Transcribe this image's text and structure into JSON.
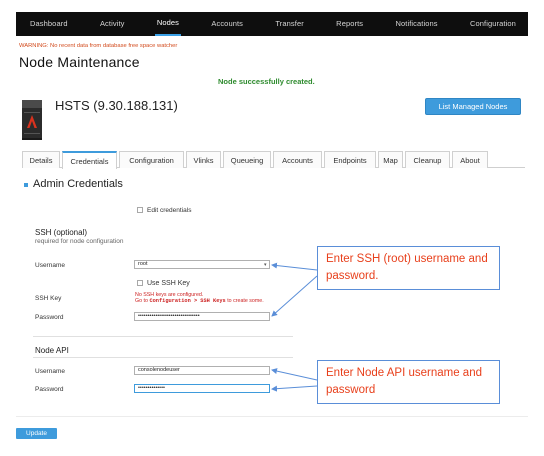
{
  "nav": {
    "items": [
      "Dashboard",
      "Activity",
      "Nodes",
      "Accounts",
      "Transfer",
      "Reports",
      "Notifications",
      "Configuration"
    ],
    "active_index": 2
  },
  "warning": "WARNING: No recent data from database free space watcher",
  "page_title": "Node Maintenance",
  "success_message": "Node successfully created.",
  "node": {
    "name": "HSTS (9.30.188.131)",
    "icon": "server-node-icon"
  },
  "managed_nodes_button": "List Managed Nodes",
  "tabs": {
    "items": [
      "Details",
      "Credentials",
      "Configuration",
      "Vlinks",
      "Queueing",
      "Accounts",
      "Endpoints",
      "Map",
      "Cleanup",
      "About"
    ],
    "active_index": 1
  },
  "section_title": "Admin Credentials",
  "edit_credentials_label": "Edit credentials",
  "ssh": {
    "title": "SSH (optional)",
    "subtitle": "required for node configuration",
    "username_label": "Username",
    "username_value": "root",
    "use_ssh_key_label": "Use SSH Key",
    "ssh_key_label": "SSH Key",
    "no_keys_msg": "No SSH keys are configured.",
    "goto_prefix": "Go to ",
    "goto_path": "Configuration > SSH Keys",
    "goto_suffix": " to create some.",
    "password_label": "Password",
    "password_value": "••••••••••••••••••••••••••••••••"
  },
  "node_api": {
    "title": "Node API",
    "username_label": "Username",
    "username_value": "consolenodeuser",
    "password_label": "Password",
    "password_value": "••••••••••••••"
  },
  "callouts": {
    "ssh": "Enter SSH (root) username and password.",
    "api": "Enter Node API username and password"
  },
  "update_button": "Update",
  "colors": {
    "accent": "#3e9bdc",
    "nav_bg": "#0e0e0e",
    "success": "#2e8b2e",
    "warning": "#d24a1c",
    "error": "#cc1f1f",
    "callout_text": "#e8401c",
    "callout_border": "#5a8ed8"
  }
}
